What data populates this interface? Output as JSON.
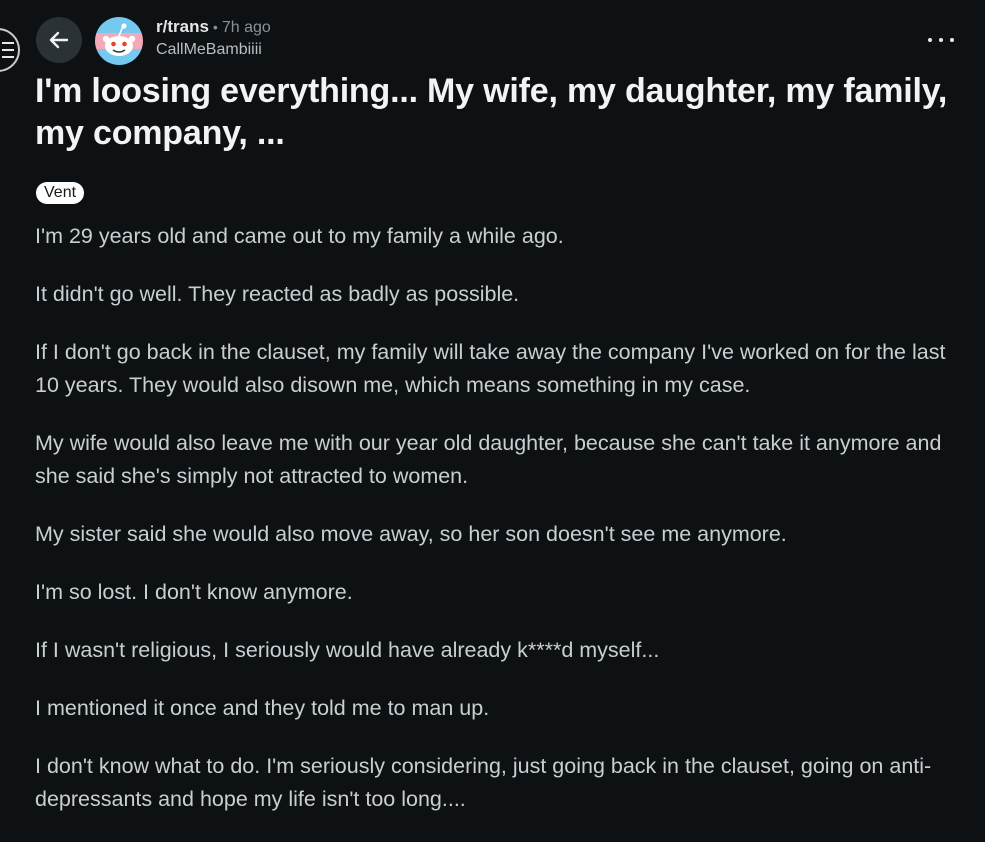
{
  "header": {
    "subreddit": "r/trans",
    "separator": "•",
    "time_ago": "7h ago",
    "author": "CallMeBambiiii"
  },
  "post": {
    "title": "I'm loosing everything... My wife, my daughter, my family, my company, ...",
    "flair": "Vent",
    "paragraphs": [
      "I'm 29 years old and came out to my family a while ago.",
      "It didn't go well. They reacted as badly as possible.",
      "If I don't go back in the clauset, my family will take away the company I've worked on for the last 10 years. They would also disown me, which means something in my case.",
      "My wife would also leave me with our year old daughter, because she can't take it anymore and she said she's simply not attracted to women.",
      "My sister said she would also move away, so her son doesn't see me anymore.",
      "I'm so lost. I don't know anymore.",
      "If I wasn't religious, I seriously would have already k****d myself...",
      "I mentioned it once and they told me to man up.",
      "I don't know what to do. I'm seriously considering, just going back in the clauset, going on anti-depressants and hope my life isn't too long...."
    ]
  },
  "icons": {
    "menu": "menu-icon",
    "back": "back-arrow-icon",
    "avatar": "snoo-avatar-icon",
    "more": "more-options-icon"
  },
  "colors": {
    "background": "#0e1113",
    "text": "#c9ced1",
    "title": "#f2f3f4",
    "flair_bg": "#ffffff",
    "button_bg": "#2a3236"
  }
}
